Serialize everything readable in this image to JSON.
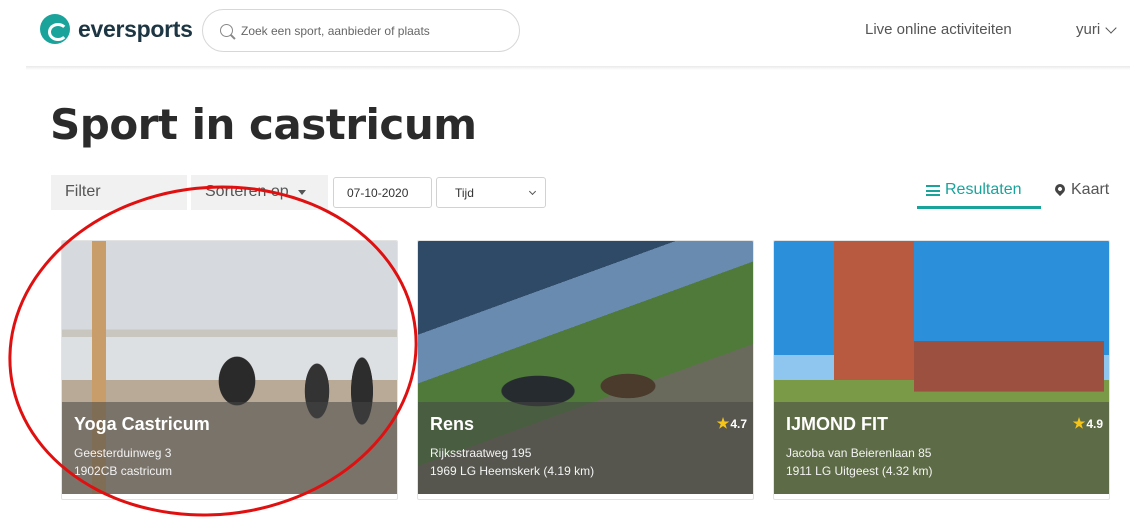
{
  "header": {
    "logo_text": "eversports",
    "search_placeholder": "Zoek een sport, aanbieder of plaats",
    "nav_live": "Live online activiteiten",
    "user_name": "yuri"
  },
  "page": {
    "title": "Sport in castricum"
  },
  "filters": {
    "filter_label": "Filter",
    "sort_label": "Sorteren op",
    "date_value": "07-10-2020",
    "time_value": "Tijd"
  },
  "view_tabs": {
    "results_label": "Resultaten",
    "map_label": "Kaart"
  },
  "cards": [
    {
      "name": "Yoga Castricum",
      "address_line1": "Geesterduinweg 3",
      "address_line2": "1902CB castricum",
      "rating": ""
    },
    {
      "name": "Rens",
      "address_line1": "Rijksstraatweg 195",
      "address_line2": "1969 LG Heemskerk (4.19 km)",
      "rating": "4.7"
    },
    {
      "name": "IJMOND FIT",
      "address_line1": "Jacoba van Beierenlaan 85",
      "address_line2": "1911 LG Uitgeest (4.32 km)",
      "rating": "4.9"
    }
  ],
  "colors": {
    "brand": "#1aa39b",
    "annotation": "#e01010",
    "star": "#f5c518"
  }
}
